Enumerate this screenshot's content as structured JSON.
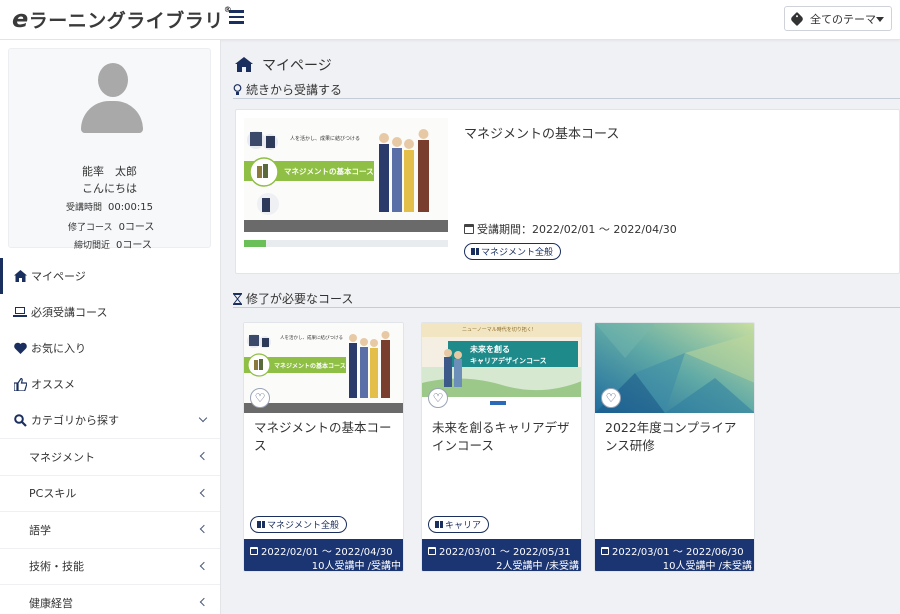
{
  "header": {
    "logo_e": "e",
    "logo_text": "ラーニングライブラリ",
    "logo_reg": "®",
    "theme_label": "全てのテーマ"
  },
  "profile": {
    "name": "能率　太郎",
    "greeting": "こんにちは",
    "stats": [
      {
        "label": "受講時間",
        "value": "00:00:15"
      },
      {
        "label": "修了コース",
        "value": "0コース"
      },
      {
        "label": "締切間近",
        "value": "0コース"
      }
    ]
  },
  "nav": {
    "items": [
      {
        "label": "マイページ",
        "icon": "home-icon"
      },
      {
        "label": "必須受講コース",
        "icon": "laptop-icon"
      },
      {
        "label": "お気に入り",
        "icon": "heart-icon"
      },
      {
        "label": "オススメ",
        "icon": "thumbs-up-icon"
      },
      {
        "label": "カテゴリから探す",
        "icon": "search-icon"
      }
    ],
    "categories": [
      "マネジメント",
      "PCスキル",
      "語学",
      "技術・技能",
      "健康経営"
    ]
  },
  "main": {
    "page_title": "マイページ",
    "continue_section": "続きから受講する",
    "required_section": "修了が必要なコース",
    "continue_course": {
      "title": "マネジメントの基本コース",
      "period": "受講期間：2022/02/01 ～ 2022/04/30",
      "tag": "マネジメント全般",
      "progress": 0.11,
      "thumb_caption": "人を活かし、成果に結びつける",
      "thumb_title": "マネジメントの基本コース"
    },
    "courses": [
      {
        "title": "マネジメントの基本コース",
        "tag": "マネジメント全般",
        "date": "2022/02/01 ～ 2022/04/30",
        "status": "10人受講中 /受講中",
        "thumb_caption": "人を活かし、成果に結びつける",
        "thumb_title": "マネジメントの基本コース"
      },
      {
        "title": "未来を創るキャリアデザインコース",
        "tag": "キャリア",
        "date": "2022/03/01 ～ 2022/05/31",
        "status": "2人受講中 /未受講",
        "thumb_caption": "ニューノーマル時代を切り拓く!",
        "thumb_title_1": "未来を創る",
        "thumb_title_2": "キャリアデザインコース"
      },
      {
        "title": "2022年度コンプライアンス研修",
        "tag": "",
        "date": "2022/03/01 ～ 2022/06/30",
        "status": "10人受講中 /未受講"
      }
    ]
  },
  "colors": {
    "navy": "#1b3572",
    "accent_green": "#6bbf59",
    "bg": "#f0f1f4"
  }
}
